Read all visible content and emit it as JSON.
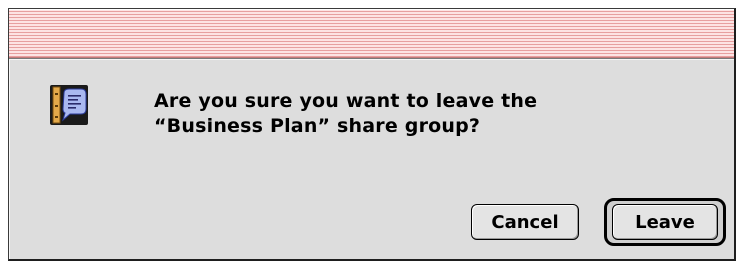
{
  "dialog": {
    "message_line1": "Are you sure you want to leave the",
    "message_line2": "“Business Plan” share group?",
    "icon": "share-group-document-icon"
  },
  "buttons": {
    "cancel_label": "Cancel",
    "leave_label": "Leave"
  },
  "colors": {
    "titlebar_stripe_light": "#fde3e3",
    "titlebar_stripe_dark": "#e79f9f",
    "window_background": "#dddddd"
  }
}
